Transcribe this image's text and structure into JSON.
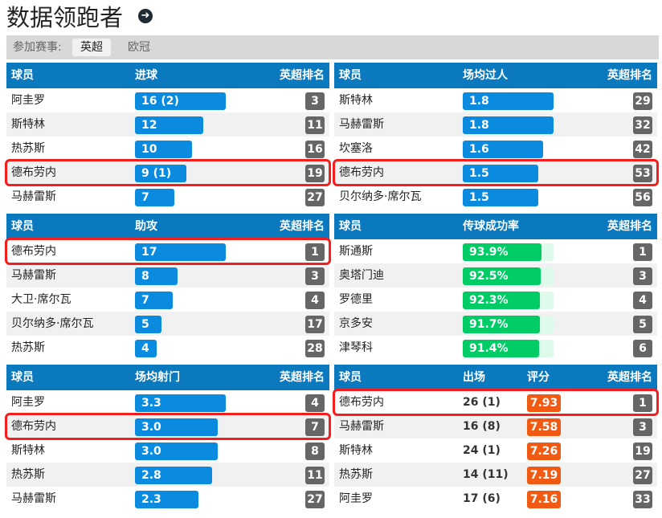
{
  "header": {
    "title": "数据领跑者",
    "arrow_icon": "arrow-right-circle-icon"
  },
  "filter": {
    "label": "参加赛事:",
    "tabs": [
      {
        "label": "英超",
        "active": true
      },
      {
        "label": "欧冠",
        "active": false
      }
    ]
  },
  "colors": {
    "header_blue": "#0b79bd",
    "bar_blue": "#0a8bdf",
    "bar_green": "#00cc66",
    "rating_orange": "#f05a12",
    "rank_gray": "#666666",
    "highlight_red": "#f51e1e"
  },
  "panels": [
    {
      "id": "goals",
      "headers": [
        "球员",
        "进球",
        "英超排名"
      ],
      "max": 16,
      "rows": [
        {
          "name": "阿圭罗",
          "value": "16 (2)",
          "num": 16,
          "rank": "3"
        },
        {
          "name": "斯特林",
          "value": "12",
          "num": 12,
          "rank": "11"
        },
        {
          "name": "热苏斯",
          "value": "10",
          "num": 10,
          "rank": "16"
        },
        {
          "name": "德布劳内",
          "value": "9 (1)",
          "num": 9,
          "rank": "19",
          "highlight": true
        },
        {
          "name": "马赫雷斯",
          "value": "7",
          "num": 7,
          "rank": "27"
        }
      ]
    },
    {
      "id": "dribbles",
      "headers": [
        "球员",
        "场均过人",
        "英超排名"
      ],
      "max": 1.8,
      "rows": [
        {
          "name": "斯特林",
          "value": "1.8",
          "num": 1.8,
          "rank": "29"
        },
        {
          "name": "马赫雷斯",
          "value": "1.8",
          "num": 1.8,
          "rank": "32"
        },
        {
          "name": "坎塞洛",
          "value": "1.6",
          "num": 1.6,
          "rank": "42"
        },
        {
          "name": "德布劳内",
          "value": "1.5",
          "num": 1.5,
          "rank": "53",
          "highlight": true
        },
        {
          "name": "贝尔纳多·席尔瓦",
          "value": "1.5",
          "num": 1.5,
          "rank": "56"
        }
      ]
    },
    {
      "id": "assists",
      "headers": [
        "球员",
        "助攻",
        "英超排名"
      ],
      "max": 17,
      "rows": [
        {
          "name": "德布劳内",
          "value": "17",
          "num": 17,
          "rank": "1",
          "highlight": true
        },
        {
          "name": "马赫雷斯",
          "value": "8",
          "num": 8,
          "rank": "3"
        },
        {
          "name": "大卫·席尔瓦",
          "value": "7",
          "num": 7,
          "rank": "4"
        },
        {
          "name": "贝尔纳多·席尔瓦",
          "value": "5",
          "num": 5,
          "rank": "17"
        },
        {
          "name": "热苏斯",
          "value": "4",
          "num": 4,
          "rank": "28"
        }
      ]
    },
    {
      "id": "pass-accuracy",
      "headers": [
        "球员",
        "传球成功率",
        "英超排名"
      ],
      "percent": true,
      "rows": [
        {
          "name": "斯通斯",
          "value": "93.9%",
          "num": 93.9,
          "rank": "1"
        },
        {
          "name": "奥塔门迪",
          "value": "92.5%",
          "num": 92.5,
          "rank": "3"
        },
        {
          "name": "罗德里",
          "value": "92.3%",
          "num": 92.3,
          "rank": "4"
        },
        {
          "name": "京多安",
          "value": "91.7%",
          "num": 91.7,
          "rank": "5"
        },
        {
          "name": "津琴科",
          "value": "91.4%",
          "num": 91.4,
          "rank": "6"
        }
      ]
    },
    {
      "id": "shots",
      "headers": [
        "球员",
        "场均射门",
        "英超排名"
      ],
      "max": 3.3,
      "rows": [
        {
          "name": "阿圭罗",
          "value": "3.3",
          "num": 3.3,
          "rank": "4"
        },
        {
          "name": "德布劳内",
          "value": "3.0",
          "num": 3.0,
          "rank": "7",
          "highlight": true
        },
        {
          "name": "斯特林",
          "value": "3.0",
          "num": 3.0,
          "rank": "8"
        },
        {
          "name": "热苏斯",
          "value": "2.8",
          "num": 2.8,
          "rank": "11"
        },
        {
          "name": "马赫雷斯",
          "value": "2.3",
          "num": 2.3,
          "rank": "27"
        }
      ]
    },
    {
      "id": "rating",
      "headers": [
        "球员",
        "出场",
        "评分",
        "英超排名"
      ],
      "rows": [
        {
          "name": "德布劳内",
          "apps": "26 (1)",
          "rating": "7.93",
          "rank": "1",
          "highlight": true
        },
        {
          "name": "马赫雷斯",
          "apps": "16 (8)",
          "rating": "7.58",
          "rank": "3"
        },
        {
          "name": "斯特林",
          "apps": "24 (1)",
          "rating": "7.26",
          "rank": "19"
        },
        {
          "name": "热苏斯",
          "apps": "14 (11)",
          "rating": "7.19",
          "rank": "27"
        },
        {
          "name": "阿圭罗",
          "apps": "17 (6)",
          "rating": "7.16",
          "rank": "33"
        }
      ]
    }
  ]
}
